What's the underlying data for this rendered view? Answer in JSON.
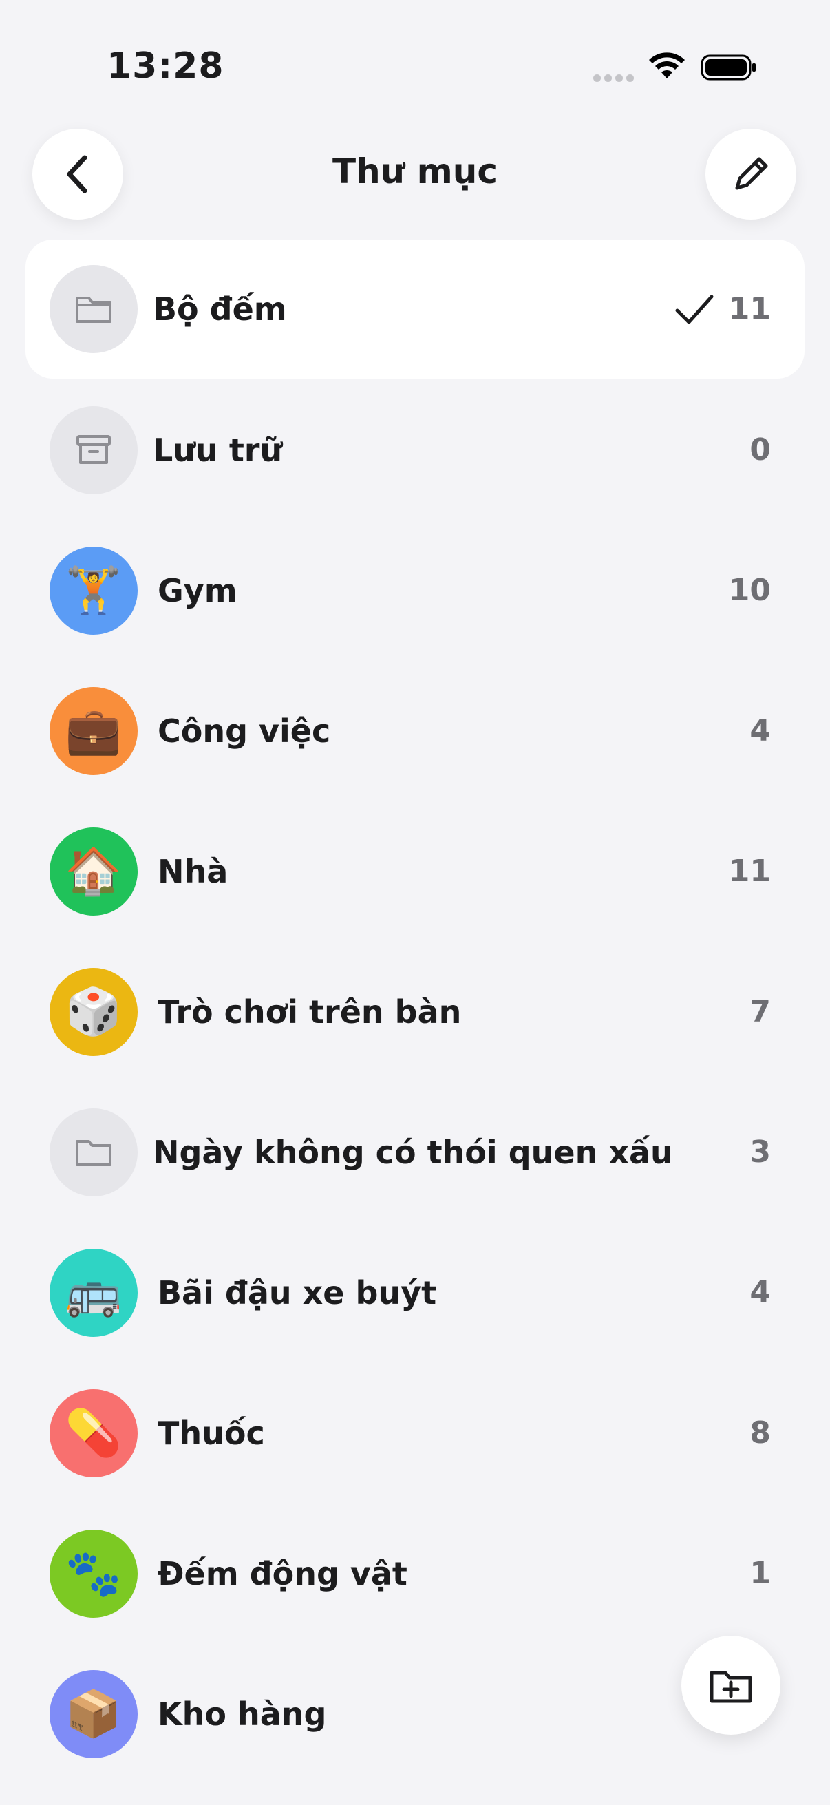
{
  "status_bar": {
    "time": "13:28"
  },
  "header": {
    "title": "Thư mục"
  },
  "colors": {
    "gym": "#5b9cf5",
    "work": "#f98e3b",
    "home": "#20c25a",
    "board_games": "#ebb712",
    "bus": "#2fd4c4",
    "medicine": "#f8706f",
    "animals": "#7cc923",
    "warehouse": "#7f8cf7"
  },
  "folders": [
    {
      "label": "Bộ đếm",
      "count": "11",
      "icon": "folder-icon",
      "selected": true
    },
    {
      "label": "Lưu trữ",
      "count": "0",
      "icon": "archive-box-icon"
    },
    {
      "label": "Gym",
      "count": "10",
      "icon": "weightlifter-emoji"
    },
    {
      "label": "Công việc",
      "count": "4",
      "icon": "briefcase-emoji"
    },
    {
      "label": "Nhà",
      "count": "11",
      "icon": "house-emoji"
    },
    {
      "label": "Trò chơi trên bàn",
      "count": "7",
      "icon": "die-emoji"
    },
    {
      "label": "Ngày không có thói quen xấu",
      "count": "3",
      "icon": "folder-icon"
    },
    {
      "label": "Bãi đậu xe buýt",
      "count": "4",
      "icon": "bus-emoji"
    },
    {
      "label": "Thuốc",
      "count": "8",
      "icon": "pill-emoji"
    },
    {
      "label": "Đếm động vật",
      "count": "1",
      "icon": "paw-prints-emoji"
    },
    {
      "label": "Kho hàng",
      "count": "",
      "icon": "package-emoji"
    }
  ]
}
